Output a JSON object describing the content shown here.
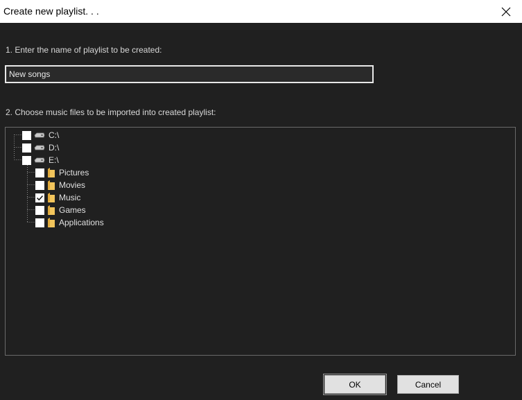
{
  "window": {
    "title": "Create new playlist. . ."
  },
  "step1": {
    "label": "1. Enter the name of playlist to be created:",
    "value": "New songs"
  },
  "step2": {
    "label": "2. Choose music files to be imported into created playlist:"
  },
  "tree": {
    "drives": [
      {
        "label": "C:\\",
        "checked": false,
        "icon": "drive-icon"
      },
      {
        "label": "D:\\",
        "checked": false,
        "icon": "drive-icon"
      },
      {
        "label": "E:\\",
        "checked": false,
        "icon": "drive-icon"
      }
    ],
    "folders": [
      {
        "label": "Pictures",
        "checked": false,
        "icon": "folder-icon"
      },
      {
        "label": "Movies",
        "checked": false,
        "icon": "folder-icon"
      },
      {
        "label": "Music",
        "checked": true,
        "icon": "folder-icon"
      },
      {
        "label": "Games",
        "checked": false,
        "icon": "folder-icon"
      },
      {
        "label": "Applications",
        "checked": false,
        "icon": "folder-icon"
      }
    ]
  },
  "buttons": {
    "ok": "OK",
    "cancel": "Cancel"
  }
}
